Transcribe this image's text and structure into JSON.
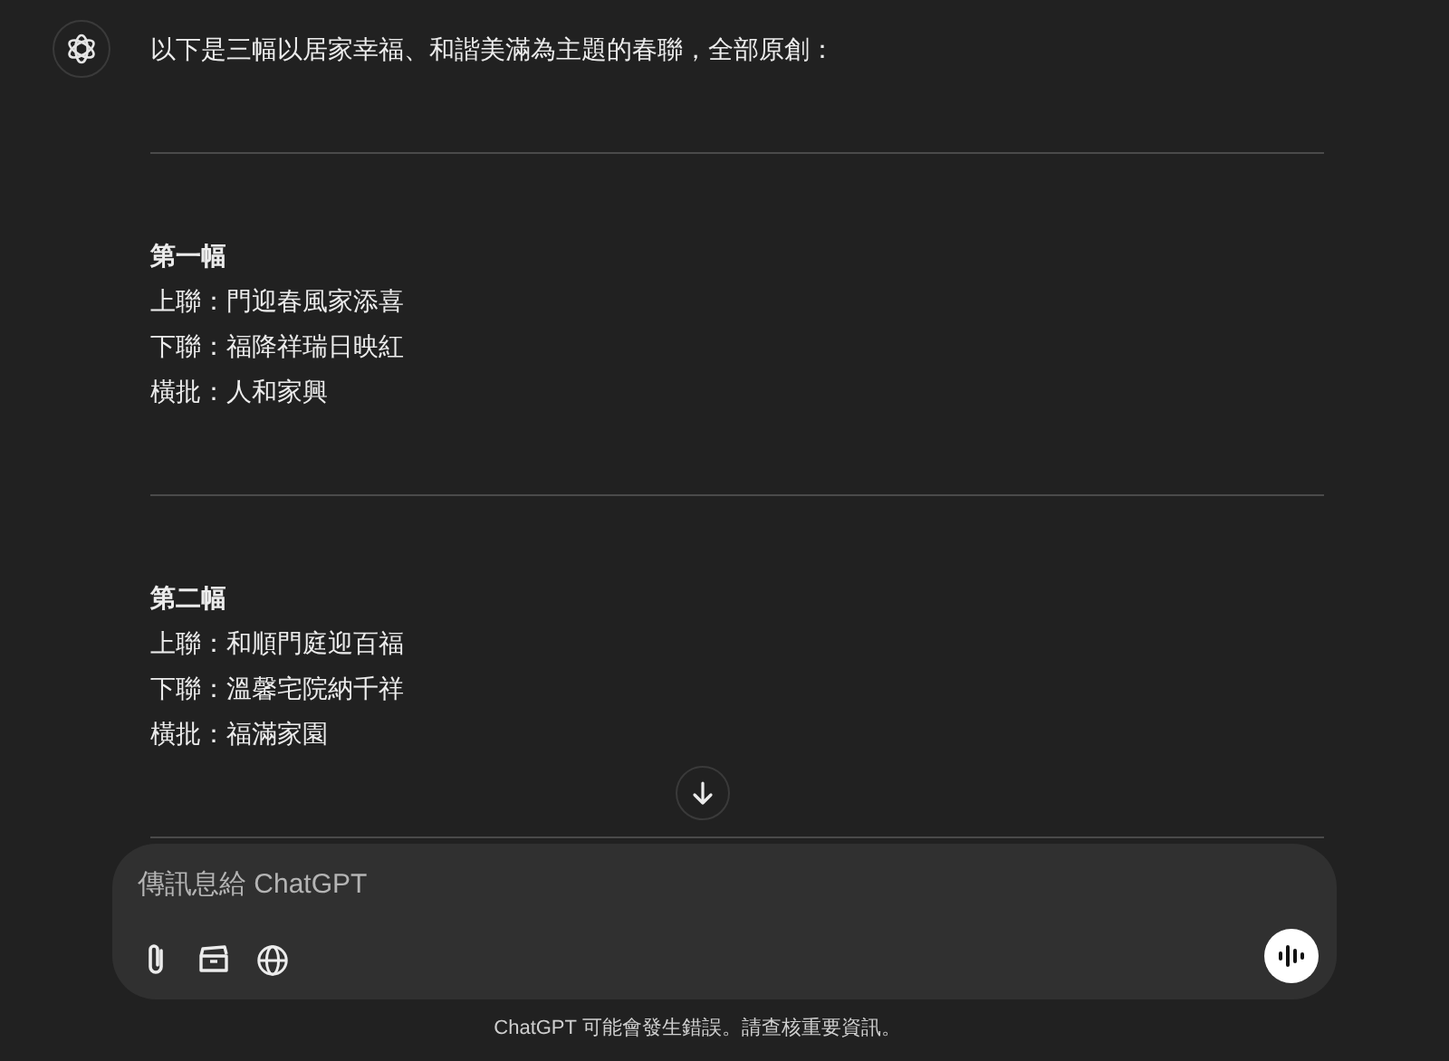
{
  "message": {
    "intro": "以下是三幅以居家幸福、和諧美滿為主題的春聯，全部原創：",
    "sections": [
      {
        "title": "第一幅",
        "lines": [
          "上聯：門迎春風家添喜",
          "下聯：福降祥瑞日映紅",
          "橫批：人和家興"
        ]
      },
      {
        "title": "第二幅",
        "lines": [
          "上聯：和順門庭迎百福",
          "下聯：溫馨宅院納千祥",
          "橫批：福滿家園"
        ]
      }
    ]
  },
  "composer": {
    "placeholder": "傳訊息給 ChatGPT"
  },
  "footer": "ChatGPT 可能會發生錯誤。請查核重要資訊。"
}
